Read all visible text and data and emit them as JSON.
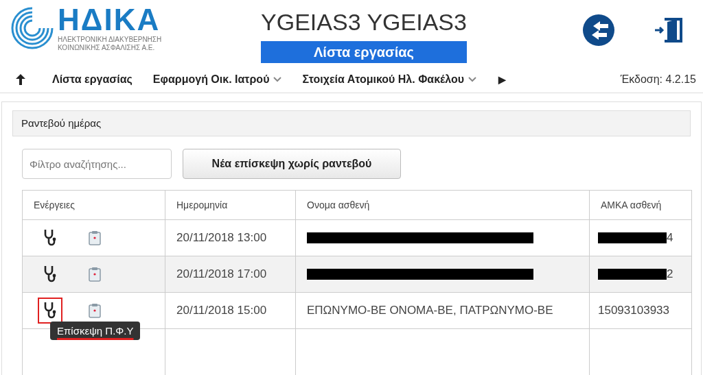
{
  "header": {
    "logo_title": "ΗΔΙΚΑ",
    "logo_subtitle": [
      "ΗΛΕΚΤΡΟΝΙΚΗ ΔΙΑΚΥΒΕΡΝΗΣΗ",
      "ΚΟΙΝΩΝΙΚΗΣ ΑΣΦΑΛΙΣΗΣ Α.Ε."
    ],
    "user": "YGEIAS3 YGEIAS3",
    "page_title": "Λίστα εργασίας"
  },
  "nav": {
    "items": [
      {
        "label": "Λίστα εργασίας",
        "dropdown": false
      },
      {
        "label": "Εφαρμογή Οικ. Ιατρού",
        "dropdown": true
      },
      {
        "label": "Στοιχεία Ατομικού Ηλ. Φακέλου",
        "dropdown": true
      }
    ],
    "more": "▶",
    "version": "Έκδοση: 4.2.15"
  },
  "panel": {
    "title": "Ραντεβού ημέρας",
    "search": {
      "placeholder": "Φίλτρο αναζήτησης..."
    },
    "new_button": "Νέα επίσκεψη χωρίς ραντεβού",
    "table": {
      "columns": [
        "Ενέργειες",
        "Ημερομηνία",
        "Ονομα ασθενή",
        "ΑΜΚΑ ασθενή"
      ],
      "rows": [
        {
          "date": "20/11/2018 13:00",
          "name_redacted": true,
          "amka": "4",
          "amka_redacted": true,
          "highlighted": false
        },
        {
          "date": "20/11/2018 17:00",
          "name_redacted": true,
          "amka": "2",
          "amka_redacted": true,
          "highlighted": false
        },
        {
          "date": "20/11/2018 15:00",
          "name": "ΕΠΩΝΥΜΟ-ΒΕ ΟΝΟΜΑ-ΒΕ, ΠΑΤΡΩΝΥΜΟ-ΒΕ",
          "name_redacted": false,
          "amka": "15093103933",
          "amka_redacted": false,
          "highlighted": true
        }
      ]
    },
    "tooltip": "Επίσκεψη Π.Φ.Υ"
  }
}
